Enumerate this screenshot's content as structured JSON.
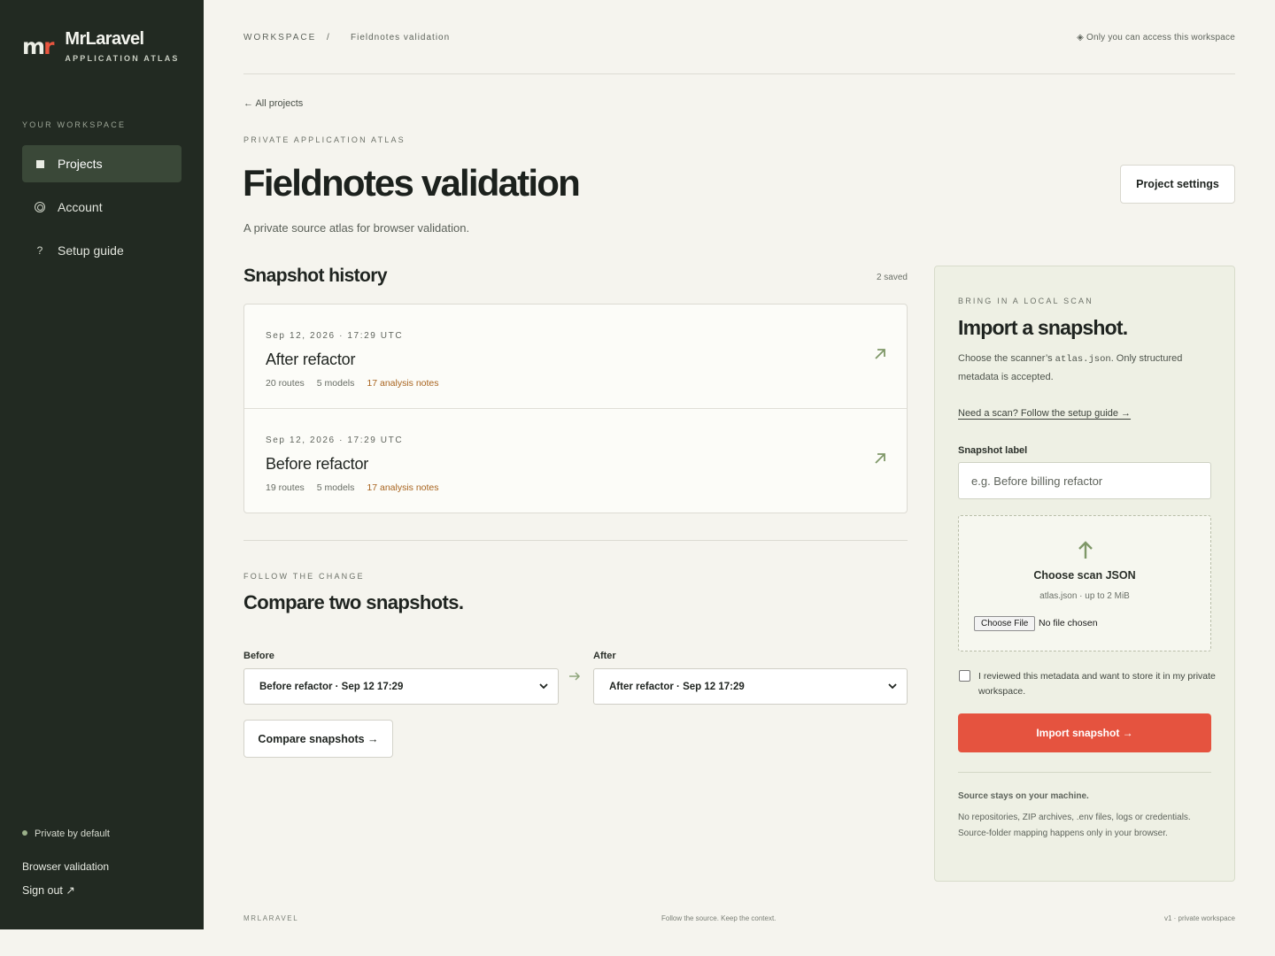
{
  "brand": {
    "logo_m": "m",
    "logo_r": "r",
    "name": "MrLaravel",
    "subtitle": "APPLICATION ATLAS"
  },
  "sidebar": {
    "section_label": "YOUR WORKSPACE",
    "items": [
      {
        "label": "Projects",
        "icon": "projects-square-icon",
        "active": true
      },
      {
        "label": "Account",
        "icon": "account-ring-icon",
        "active": false
      },
      {
        "label": "Setup guide",
        "icon": "question-icon",
        "glyph": "?",
        "active": false
      }
    ],
    "privacy_note": "Private by default",
    "workspace_link": "Browser validation",
    "sign_out": "Sign out ↗"
  },
  "topbar": {
    "crumbs": [
      "WORKSPACE",
      "Fieldnotes validation"
    ],
    "separator": "/",
    "access_note": "◈ Only you can access this workspace"
  },
  "page": {
    "back_link": "← All projects",
    "eyebrow": "PRIVATE APPLICATION ATLAS",
    "title": "Fieldnotes validation",
    "description": "A private source atlas for browser validation.",
    "settings_button": "Project settings"
  },
  "history": {
    "title": "Snapshot history",
    "count": "2 saved",
    "snapshots": [
      {
        "date": "Sep 12, 2026 · 17:29 UTC",
        "name": "After refactor",
        "routes": "20 routes",
        "models": "5 models",
        "notes": "17 analysis notes"
      },
      {
        "date": "Sep 12, 2026 · 17:29 UTC",
        "name": "Before refactor",
        "routes": "19 routes",
        "models": "5 models",
        "notes": "17 analysis notes"
      }
    ]
  },
  "compare": {
    "eyebrow": "FOLLOW THE CHANGE",
    "title": "Compare two snapshots.",
    "before_label": "Before",
    "before_value": "Before refactor · Sep 12 17:29",
    "after_label": "After",
    "after_value": "After refactor · Sep 12 17:29",
    "button": "Compare snapshots →"
  },
  "import": {
    "eyebrow": "BRING IN A LOCAL SCAN",
    "title": "Import a snapshot.",
    "desc_before": "Choose the scanner’s ",
    "desc_code": "atlas.json",
    "desc_after": ". Only structured metadata is accepted.",
    "setup_link": "Need a scan? Follow the setup guide →",
    "label_field": "Snapshot label",
    "label_placeholder": "e.g. Before billing refactor",
    "dropzone_title": "Choose scan JSON",
    "dropzone_sub": "atlas.json · up to 2 MiB",
    "file_button": "Choose File",
    "file_status": "No file chosen",
    "consent": "I reviewed this metadata and want to store it in my private workspace.",
    "submit": "Import snapshot →",
    "note_title": "Source stays on your machine.",
    "note_text": "No repositories, ZIP archives, .env files, logs or credentials. Source-folder mapping happens only in your browser."
  },
  "footer": {
    "left": "MRLARAVEL",
    "center": "Follow the source. Keep the context.",
    "right": "v1 · private workspace"
  },
  "colors": {
    "sidebar_bg": "#222a22",
    "page_bg": "#f5f4ee",
    "accent_red": "#e5533f",
    "notes_amber": "#a8641f",
    "sage_arrow": "#7f9868"
  }
}
